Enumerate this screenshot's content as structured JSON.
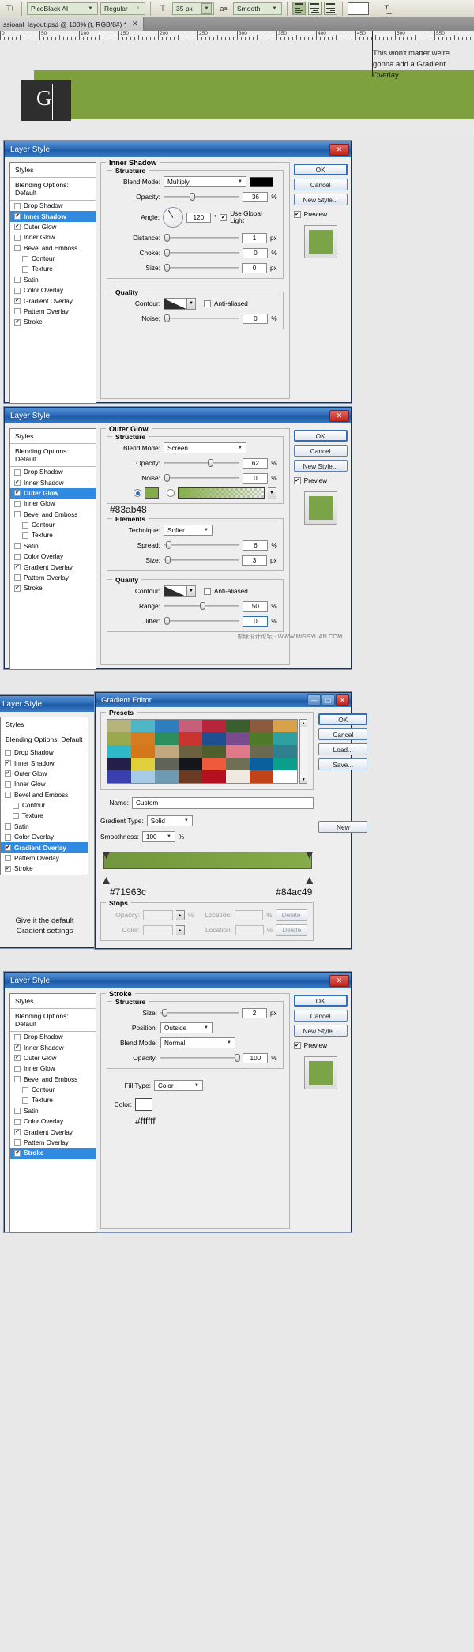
{
  "toolbar": {
    "type_tool_icon": "text-tool-icon",
    "font_family": "PicoBlack AI",
    "font_style": "Regular",
    "size_icon": "font-size-icon",
    "font_size": "35 px",
    "aa_icon": "anti-alias-icon",
    "anti_alias": "Smooth",
    "align_left": "align-left-icon",
    "align_center": "align-center-icon",
    "align_right": "align-right-icon",
    "text_color": "#ffffff",
    "warp_icon": "warp-text-icon"
  },
  "document": {
    "tab_title": "ssioanl_layout.psd @ 100% (t, RGB/8#) *",
    "close_glyph": "✕",
    "ruler_labels": [
      "0",
      "50",
      "100",
      "150",
      "200",
      "250",
      "300",
      "350",
      "400",
      "450",
      "500",
      "550"
    ],
    "note": "This won't matter we're gonna add a Gradient Overlay",
    "banner_color": "#7ea03f",
    "logo_box_color": "#2e2e2e",
    "logo_glyph": "G"
  },
  "styles_list": {
    "header": "Styles",
    "blending": "Blending Options: Default",
    "items": [
      {
        "label": "Drop Shadow",
        "checked": false,
        "indent": false
      },
      {
        "label": "Inner Shadow",
        "checked": true,
        "indent": false
      },
      {
        "label": "Outer Glow",
        "checked": true,
        "indent": false
      },
      {
        "label": "Inner Glow",
        "checked": false,
        "indent": false
      },
      {
        "label": "Bevel and Emboss",
        "checked": false,
        "indent": false
      },
      {
        "label": "Contour",
        "checked": false,
        "indent": true
      },
      {
        "label": "Texture",
        "checked": false,
        "indent": true
      },
      {
        "label": "Satin",
        "checked": false,
        "indent": false
      },
      {
        "label": "Color Overlay",
        "checked": false,
        "indent": false
      },
      {
        "label": "Gradient Overlay",
        "checked": true,
        "indent": false
      },
      {
        "label": "Pattern Overlay",
        "checked": false,
        "indent": false
      },
      {
        "label": "Stroke",
        "checked": true,
        "indent": false
      }
    ]
  },
  "buttons": {
    "title": "Layer Style",
    "ok": "OK",
    "cancel": "Cancel",
    "new_style": "New Style...",
    "preview": "Preview",
    "close": "✕"
  },
  "dialog1": {
    "section_title": "Inner Shadow",
    "structure": "Structure",
    "quality": "Quality",
    "blend_mode_label": "Blend Mode:",
    "blend_mode": "Multiply",
    "shadow_color": "#000000",
    "opacity_label": "Opacity:",
    "opacity": "36",
    "angle_label": "Angle:",
    "angle": "120",
    "degree": "°",
    "use_global_light": "Use Global Light",
    "distance_label": "Distance:",
    "distance": "1",
    "choke_label": "Choke:",
    "choke": "0",
    "size_label": "Size:",
    "size": "0",
    "px": "px",
    "pct": "%",
    "contour_label": "Contour:",
    "anti_aliased": "Anti-aliased",
    "noise_label": "Noise:",
    "noise": "0",
    "selected_style": "Inner Shadow"
  },
  "dialog2": {
    "section_title": "Outer Glow",
    "structure": "Structure",
    "elements": "Elements",
    "quality": "Quality",
    "blend_mode_label": "Blend Mode:",
    "blend_mode": "Screen",
    "opacity_label": "Opacity:",
    "opacity": "62",
    "noise_label": "Noise:",
    "noise": "0",
    "glow_color": "#83ab48",
    "glow_hex_label": "#83ab48",
    "technique_label": "Technique:",
    "technique": "Softer",
    "spread_label": "Spread:",
    "spread": "6",
    "size_label": "Size:",
    "size": "3",
    "contour_label": "Contour:",
    "anti_aliased": "Anti-aliased",
    "range_label": "Range:",
    "range": "50",
    "jitter_label": "Jitter:",
    "jitter": "0",
    "px": "px",
    "pct": "%",
    "selected_style": "Outer Glow",
    "watermark": "思缘设计论坛 - WWW.MISSYUAN.COM"
  },
  "dialog3": {
    "selected_style": "Gradient Overlay",
    "tip": "Give it the default Gradient settings"
  },
  "gradient_editor": {
    "title": "Gradient Editor",
    "presets_label": "Presets",
    "ok": "OK",
    "cancel": "Cancel",
    "load": "Load...",
    "save": "Save...",
    "new": "New",
    "name_label": "Name:",
    "name_value": "Custom",
    "gradient_type_label": "Gradient Type:",
    "gradient_type": "Solid",
    "smoothness_label": "Smoothness:",
    "smoothness": "100",
    "pct": "%",
    "stops_label": "Stops",
    "opacity_label": "Opacity:",
    "location_label": "Location:",
    "delete_label": "Delete",
    "color_label": "Color:",
    "left_stop_hex": "#71963c",
    "right_stop_hex": "#84ac49",
    "preset_colors": [
      "#b6b47a",
      "#4fb6c8",
      "#2f7fc0",
      "#c85f7a",
      "#b9243d",
      "#3a5f2e",
      "#8c5a3c",
      "#d8a24a",
      "#9aa84e",
      "#d47c1f",
      "#2a8f5c",
      "#c9342e",
      "#1f4f8f",
      "#7a4a8f",
      "#4f7a2a",
      "#2f9f9f",
      "#2fb8c8",
      "#d4761a",
      "#c2a87c",
      "#6b6040",
      "#4f5e2a",
      "#e07a8a",
      "#6b6a50",
      "#2f7f8f",
      "#22204a",
      "#e0cf3a",
      "#5f6358",
      "#14161c",
      "#ef5a3c",
      "#6e6f55",
      "#0a5f9f",
      "#0a9f8a",
      "#3a3fb0",
      "#a6cae8",
      "#6e9ab4",
      "#6a3a22",
      "#b4101f",
      "#efe9df",
      "#c04418",
      "#ffffff"
    ]
  },
  "dialog4": {
    "section_title": "Stroke",
    "structure": "Structure",
    "size_label": "Size:",
    "size": "2",
    "position_label": "Position:",
    "position": "Outside",
    "blend_mode_label": "Blend Mode:",
    "blend_mode": "Normal",
    "opacity_label": "Opacity:",
    "opacity": "100",
    "fill_type_label": "Fill Type:",
    "fill_type": "Color",
    "color_label": "Color:",
    "stroke_color": "#ffffff",
    "stroke_hex_label": "#ffffff",
    "px": "px",
    "pct": "%",
    "selected_style": "Stroke"
  }
}
